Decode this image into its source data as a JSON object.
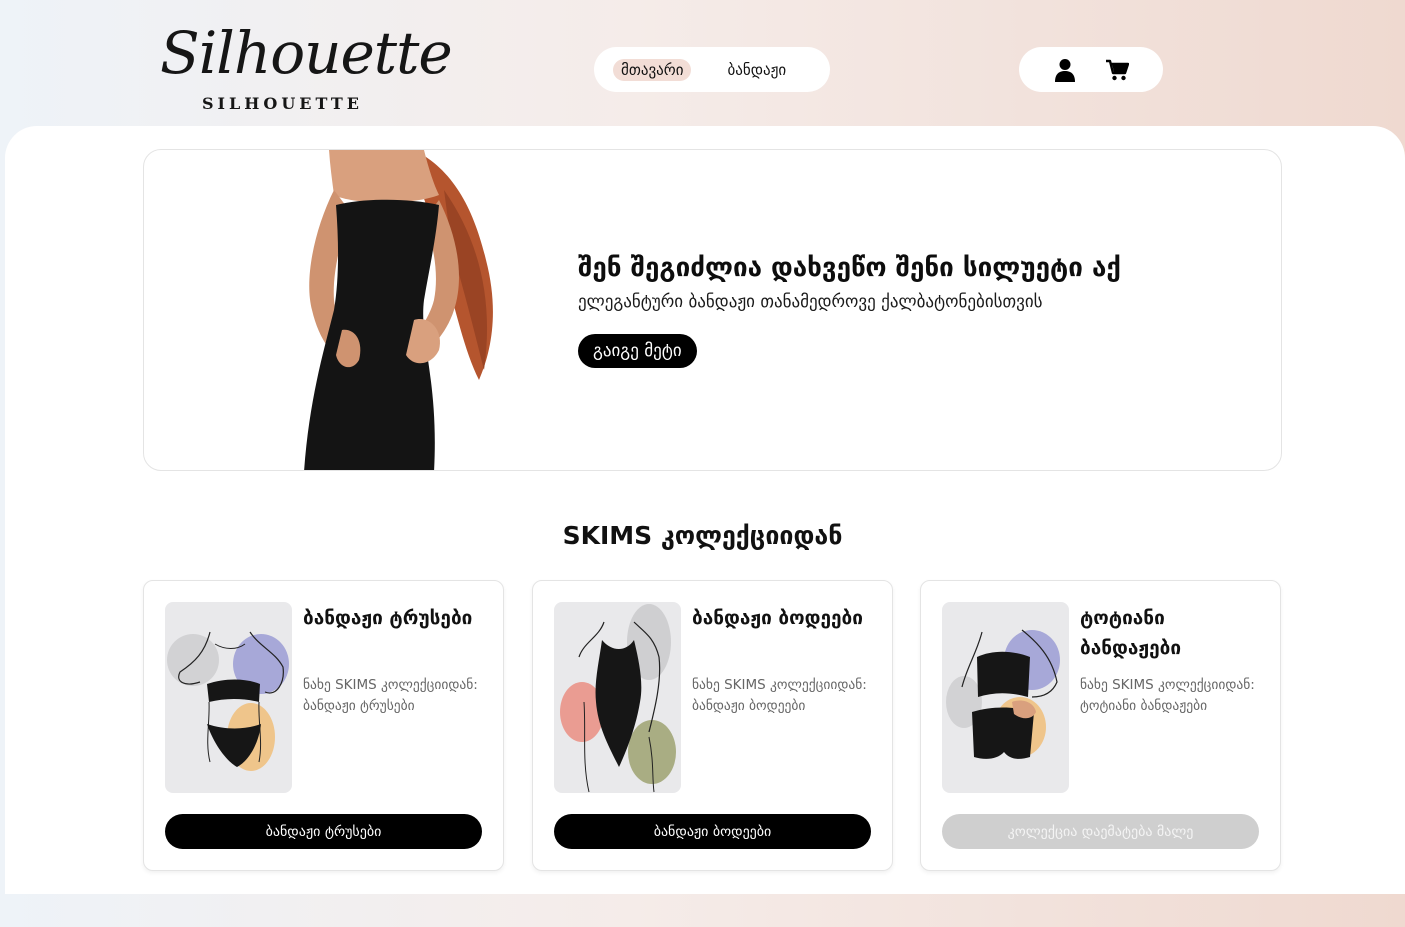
{
  "header": {
    "logo_script": "Silhouette",
    "logo_sub": "SILHOUETTE",
    "nav": [
      {
        "label": "მთავარი",
        "active": true
      },
      {
        "label": "ბანდაჟი",
        "active": false
      }
    ],
    "icons": [
      "user-icon",
      "cart-icon"
    ]
  },
  "hero": {
    "title": "შენ შეგიძლია დახვეწო შენი სილუეტი აქ",
    "subtitle": "ელეგანტური ბანდაჟი თანამედროვე ქალბატონებისთვის",
    "button": "გაიგე მეტი"
  },
  "collection": {
    "title": "SKIMS კოლექციიდან",
    "cards": [
      {
        "title": "ბანდაჟი ტრუსები",
        "desc": "ნახე SKIMS კოლექციიდან: ბანდაჟი ტრუსები",
        "button": "ბანდაჟი ტრუსები",
        "disabled": false
      },
      {
        "title": "ბანდაჟი ბოდეები",
        "desc": "ნახე SKIMS კოლექციიდან: ბანდაჟი ბოდეები",
        "button": "ბანდაჟი ბოდეები",
        "disabled": false
      },
      {
        "title": "ტოტიანი ბანდაჟები",
        "desc": "ნახე SKIMS კოლექციიდან: ტოტიანი ბანდაჟები",
        "button": "კოლექცია დაემატება მალე",
        "disabled": true
      }
    ]
  },
  "colors": {
    "accent_pill": "#f2ddd6",
    "button": "#000000",
    "disabled_button": "#cfcfcf"
  }
}
